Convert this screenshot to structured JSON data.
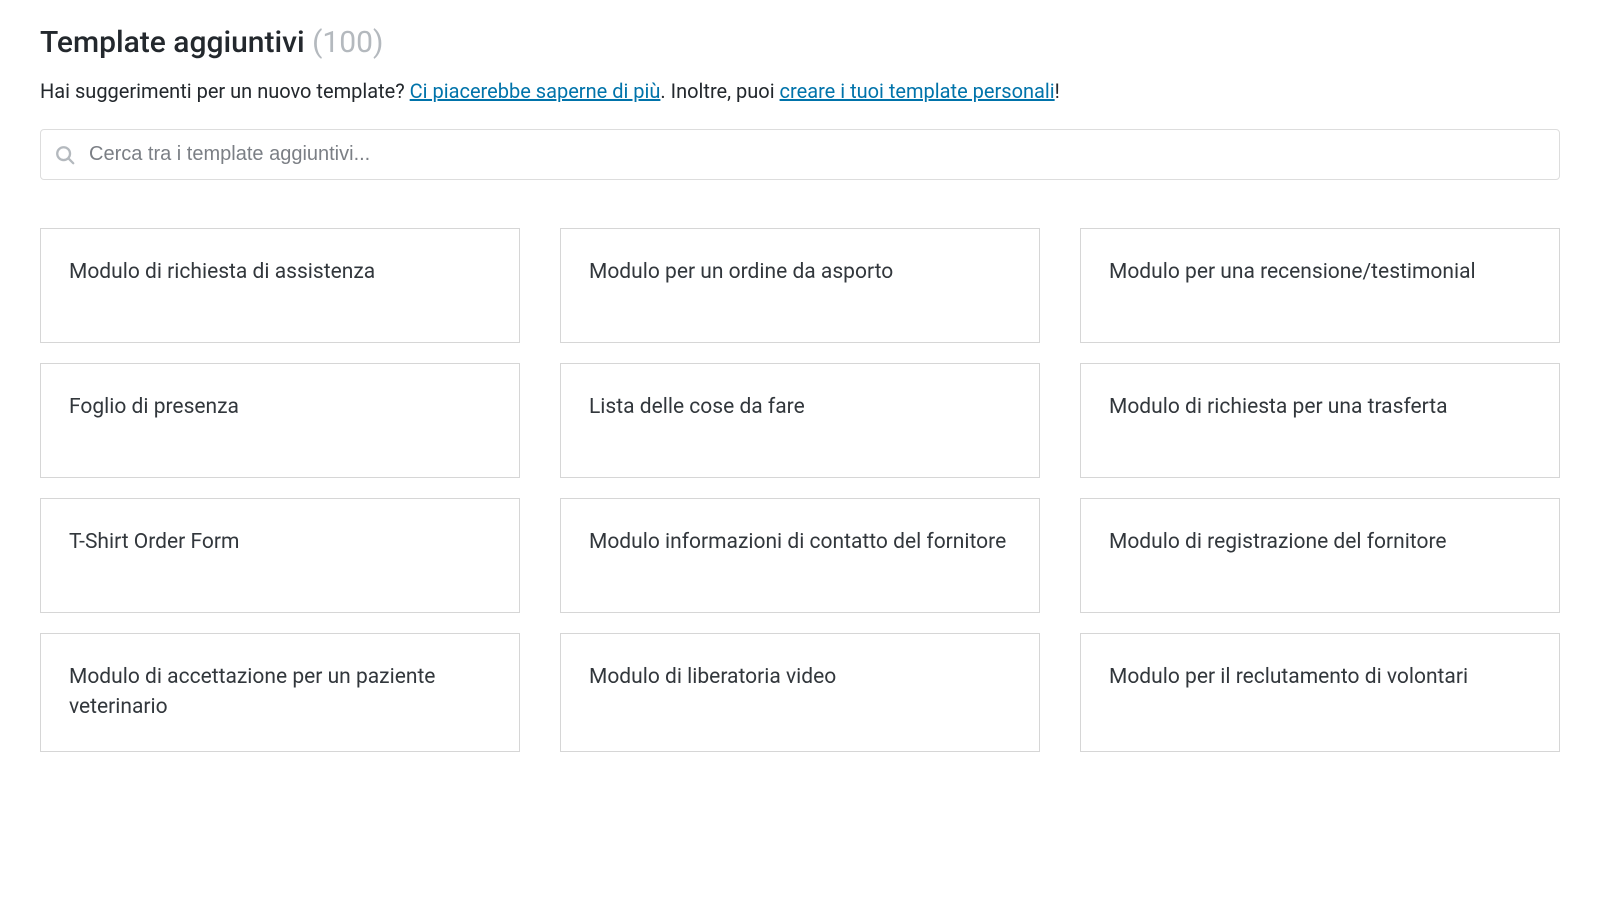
{
  "header": {
    "title": "Template aggiuntivi",
    "count": "(100)"
  },
  "subtitle": {
    "prefix": "Hai suggerimenti per un nuovo template? ",
    "link1": "Ci piacerebbe saperne di più",
    "middle": ". Inoltre, puoi ",
    "link2": "creare i tuoi template personali",
    "suffix": "!"
  },
  "search": {
    "placeholder": "Cerca tra i template aggiuntivi..."
  },
  "templates": [
    {
      "title": "Modulo di richiesta di assistenza"
    },
    {
      "title": "Modulo per un ordine da asporto"
    },
    {
      "title": "Modulo per una recensione/testimonial"
    },
    {
      "title": "Foglio di presenza"
    },
    {
      "title": "Lista delle cose da fare"
    },
    {
      "title": "Modulo di richiesta per una trasferta"
    },
    {
      "title": "T-Shirt Order Form"
    },
    {
      "title": "Modulo informazioni di contatto del fornitore"
    },
    {
      "title": "Modulo di registrazione del fornitore"
    },
    {
      "title": "Modulo di accettazione per un paziente veterinario"
    },
    {
      "title": "Modulo di liberatoria video"
    },
    {
      "title": "Modulo per il reclutamento di volontari"
    }
  ]
}
